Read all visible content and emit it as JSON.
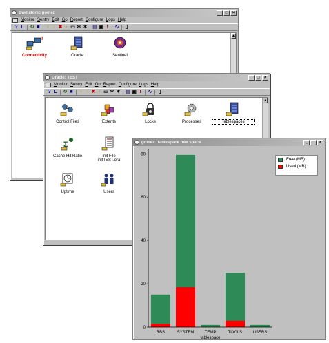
{
  "win1": {
    "title": "Bwd atonic gomez",
    "menus": [
      "Monitor",
      "Sentry",
      "Edit",
      "Go",
      "Report",
      "Configure",
      "Logs",
      "Help"
    ],
    "icons": [
      {
        "label": "Connectivity",
        "color": "#c00000"
      },
      {
        "label": "Oracle",
        "color": "#000000"
      },
      {
        "label": "Sentinel",
        "color": "#000000"
      }
    ]
  },
  "win2": {
    "title": "Oracle: TEST",
    "menus": [
      "Monitor",
      "Sentry",
      "Edit",
      "Go",
      "Report",
      "Configure",
      "Logs",
      "Help"
    ],
    "icons": [
      {
        "label": "Control Files"
      },
      {
        "label": "Extents"
      },
      {
        "label": "Locks"
      },
      {
        "label": "Processes"
      },
      {
        "label": "Tablespaces"
      },
      {
        "label": "Cache Hit Ratio"
      },
      {
        "label": "Init File",
        "label2": "initTEST.ora"
      },
      {
        "label": "Uptime"
      },
      {
        "label": "Users"
      }
    ]
  },
  "chartwin": {
    "title": "gomez: Tablespace free space"
  },
  "window_buttons": [
    "_",
    "□",
    "×"
  ],
  "colors": {
    "free": "#2e8b57",
    "used": "#ff0000"
  },
  "chart_data": {
    "type": "bar",
    "stacked": true,
    "categories": [
      "RBS",
      "SYSTEM",
      "TEMP",
      "TOOLS",
      "USERS"
    ],
    "series": [
      {
        "name": "Used (MB)",
        "values": [
          1.5,
          18.5,
          0,
          3,
          0
        ]
      },
      {
        "name": "Free (MB)",
        "values": [
          13.5,
          61,
          1,
          22,
          1
        ]
      }
    ],
    "xlabel": "tablespace",
    "ylabel": "",
    "ylim": [
      0,
      82
    ],
    "yticks": [
      0,
      20,
      40,
      60,
      80
    ],
    "legend_position": "top-right"
  }
}
